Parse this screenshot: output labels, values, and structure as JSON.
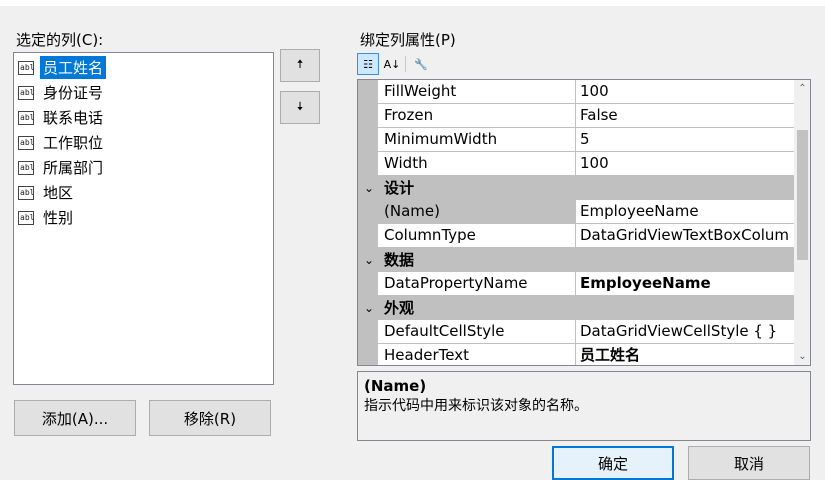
{
  "left": {
    "title": "选定的列(C):",
    "items": [
      {
        "label": "员工姓名",
        "selected": true
      },
      {
        "label": "身份证号"
      },
      {
        "label": "联系电话"
      },
      {
        "label": "工作职位"
      },
      {
        "label": "所属部门"
      },
      {
        "label": "地区"
      },
      {
        "label": "性别"
      }
    ],
    "icon_text": "abl",
    "up_glyph": "🠅",
    "down_glyph": "🠇",
    "add_label": "添加(A)...",
    "remove_label": "移除(R)"
  },
  "right": {
    "title": "绑定列属性(P)",
    "toolbar": {
      "categorized_glyph": "☷",
      "alpha_glyph": "A↓",
      "props_glyph": "🔧"
    },
    "grid": [
      {
        "name": "FillWeight",
        "value": "100"
      },
      {
        "name": "Frozen",
        "value": "False"
      },
      {
        "name": "MinimumWidth",
        "value": "5"
      },
      {
        "name": "Width",
        "value": "100"
      },
      {
        "category": "设计"
      },
      {
        "name": "(Name)",
        "value": "EmployeeName",
        "selected": true
      },
      {
        "name": "ColumnType",
        "value": "DataGridViewTextBoxColum"
      },
      {
        "category": "数据"
      },
      {
        "name": "DataPropertyName",
        "value": "EmployeeName",
        "bold": true
      },
      {
        "category": "外观"
      },
      {
        "name": "DefaultCellStyle",
        "value": "DataGridViewCellStyle { }"
      },
      {
        "name": "HeaderText",
        "value": "员工姓名",
        "bold": true
      }
    ],
    "chevron": "⌄",
    "scroll_up": "⌃",
    "scroll_down": "⌄",
    "description": {
      "title": "(Name)",
      "text": "指示代码中用来标识该对象的名称。"
    }
  },
  "footer": {
    "ok_label": "确定",
    "cancel_label": "取消"
  },
  "colors": {
    "selection": "#0078d7",
    "gutter": "#c0c0c0",
    "dialog_bg": "#f0f0f0"
  }
}
